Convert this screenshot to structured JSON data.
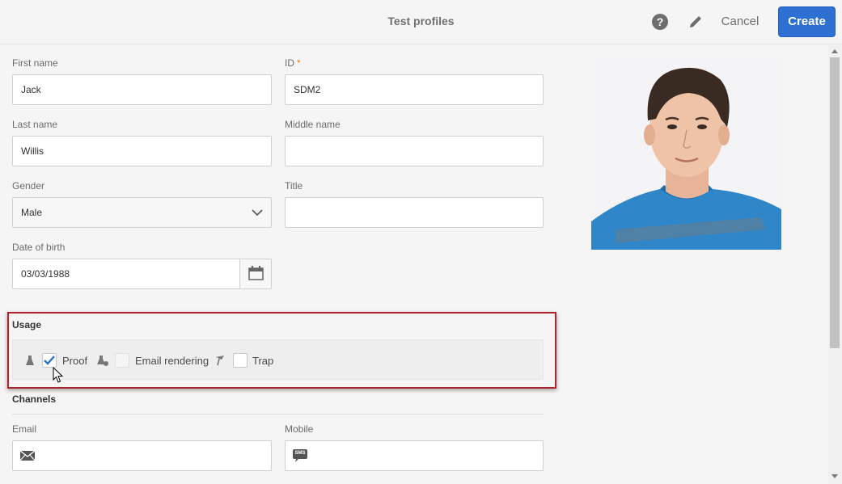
{
  "header": {
    "title": "Test profiles",
    "help_glyph": "?",
    "cancel_label": "Cancel",
    "create_label": "Create"
  },
  "form": {
    "first_name": {
      "label": "First name",
      "value": "Jack"
    },
    "id": {
      "label": "ID",
      "required_mark": "*",
      "value": "SDM2"
    },
    "last_name": {
      "label": "Last name",
      "value": "Willis"
    },
    "middle_name": {
      "label": "Middle name",
      "value": ""
    },
    "gender": {
      "label": "Gender",
      "value": "Male"
    },
    "title": {
      "label": "Title",
      "value": ""
    },
    "date_of_birth": {
      "label": "Date of birth",
      "value": "03/03/1988"
    }
  },
  "usage": {
    "title": "Usage",
    "options": [
      {
        "label": "Proof",
        "checked": true,
        "icon": "flask-icon"
      },
      {
        "label": "Email rendering",
        "checked": false,
        "icon": "flask-check-icon"
      },
      {
        "label": "Trap",
        "checked": false,
        "icon": "trap-icon"
      }
    ]
  },
  "channels": {
    "title": "Channels",
    "email": {
      "label": "Email",
      "value": "",
      "icon": "envelope-icon"
    },
    "mobile": {
      "label": "Mobile",
      "value": "",
      "icon": "sms-icon",
      "icon_text": "SMS"
    }
  },
  "colors": {
    "accent": "#2d70d2",
    "highlight_border": "#b0222e",
    "required": "#e68619",
    "check": "#2d70d2"
  }
}
